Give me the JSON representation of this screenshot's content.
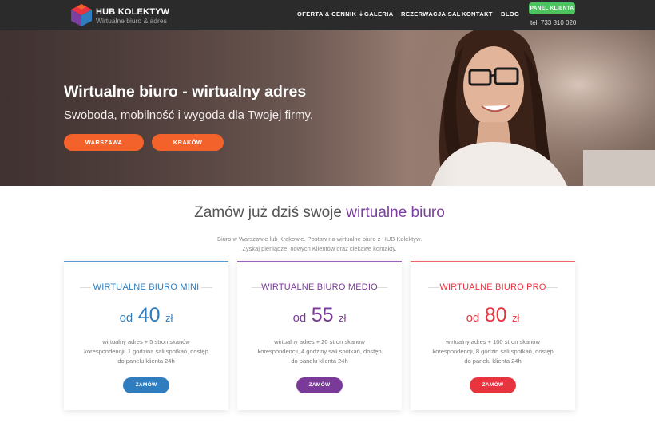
{
  "brand": {
    "title": "HUB KOLEKTYW",
    "subtitle": "Wirtualne biuro & adres"
  },
  "nav": {
    "items": [
      {
        "label": "OFERTA & CENNIK ⇣"
      },
      {
        "label": "GALERIA"
      },
      {
        "label": "REZERWACJA SAL"
      },
      {
        "label": "KONTAKT"
      },
      {
        "label": "BLOG"
      }
    ],
    "panel_button": "PANEL KLIENTA",
    "phone": "tel. 733 810 020"
  },
  "hero": {
    "title": "Wirtualne biuro - wirtualny adres",
    "subtitle": "Swoboda, mobilność i wygoda dla Twojej firmy.",
    "buttons": [
      {
        "label": "WARSZAWA"
      },
      {
        "label": "KRAKÓW"
      }
    ]
  },
  "section": {
    "title_plain": "Zamów już dziś swoje ",
    "title_accent": "wirtualne biuro",
    "intro_line1": "Biuro w Warszawie lub Krakowie. Postaw na wirtualne biuro z HUB Kolektyw.",
    "intro_line2": "Zyskaj pieniądze, nowych Klientów oraz ciekawe kontakty."
  },
  "plans": [
    {
      "name": "WIRTUALNE BIURO MINI",
      "price_prefix": "od",
      "price": "40",
      "currency": "zł",
      "desc1": "wirtualny adres + 5 stron skanów",
      "desc2": "korespondencji, 1 godzina sali spotkań, dostęp",
      "desc3": "do panelu klienta 24h",
      "button": "ZAMÓW",
      "color": "#2f7dbf"
    },
    {
      "name": "WIRTUALNE BIURO MEDIO",
      "price_prefix": "od",
      "price": "55",
      "currency": "zł",
      "desc1": "wirtualny adres + 20 stron skanów",
      "desc2": "korespondencji, 4 godziny sali spotkań, dostęp",
      "desc3": "do panelu klienta 24h",
      "button": "ZAMÓW",
      "color": "#7a3a98"
    },
    {
      "name": "WIRTUALNE BIURO PRO",
      "price_prefix": "od",
      "price": "80",
      "currency": "zł",
      "desc1": "wirtualny adres + 100 stron skanów",
      "desc2": "korespondencji, 8 godzin sali spotkań, dostęp",
      "desc3": "do panelu klienta 24h",
      "button": "ZAMÓW",
      "color": "#e8343f"
    }
  ],
  "colors": {
    "accent_orange": "#f4622c",
    "accent_purple": "#7b3fa0",
    "panel_green": "#4cc35f",
    "nav_bg": "#2b2b2b"
  }
}
